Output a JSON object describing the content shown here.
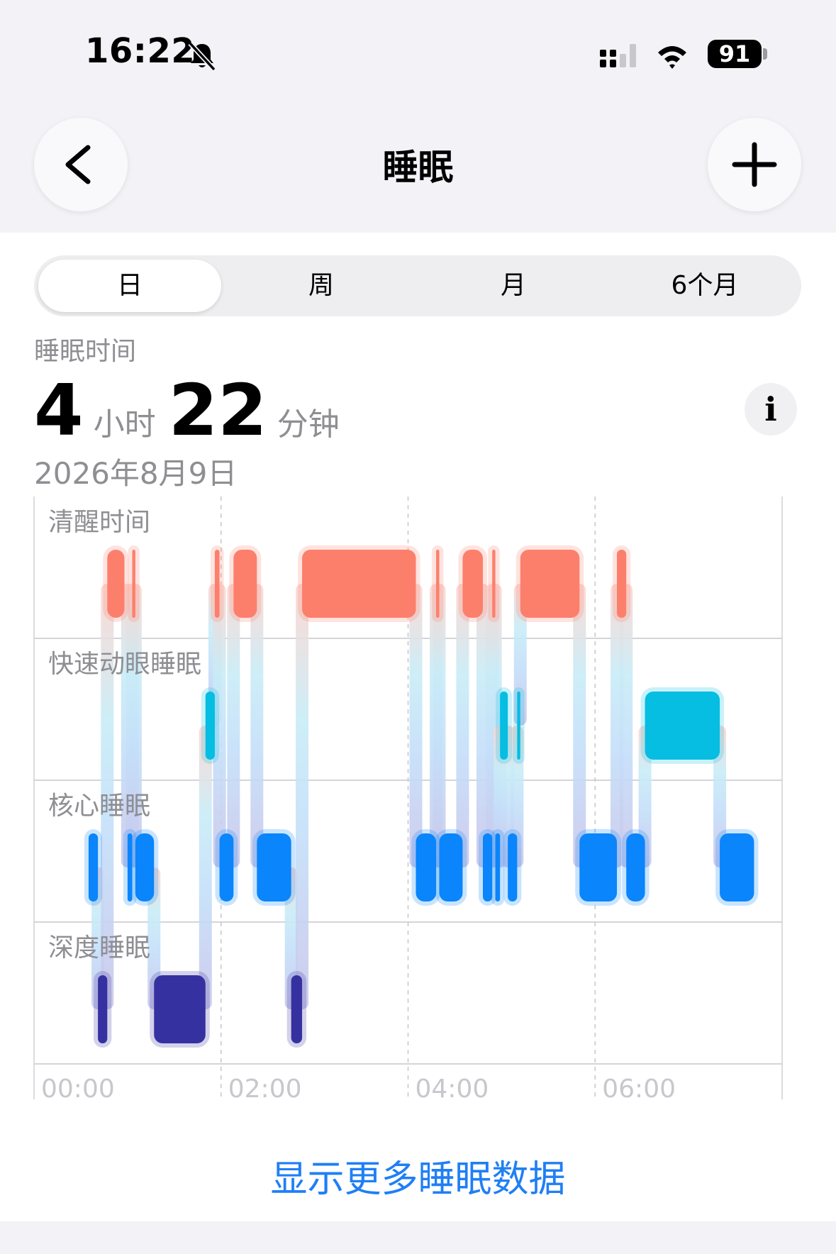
{
  "status_bar": {
    "time": "16:22",
    "battery": "91"
  },
  "nav": {
    "title": "睡眠"
  },
  "segments": [
    "日",
    "周",
    "月",
    "6个月"
  ],
  "summary": {
    "label": "睡眠时间",
    "hours": "4",
    "hours_unit": "小时",
    "minutes": "22",
    "minutes_unit": "分钟",
    "date": "2026年8月9日",
    "info_symbol": "i"
  },
  "chart_data": {
    "type": "sleep-stage-timeline",
    "stages": [
      "清醒时间",
      "快速动眼睡眠",
      "核心睡眠",
      "深度睡眠"
    ],
    "x_tick_labels": [
      "00:00",
      "02:00",
      "04:00",
      "06:00"
    ],
    "x_range_hours": [
      0,
      8
    ],
    "colors": {
      "awake": "#fc7f6c",
      "rem": "#06bde2",
      "core": "#0a85fb",
      "deep": "#3631a0"
    },
    "segments": [
      {
        "stage": "core",
        "start": "00:35",
        "end": "00:41"
      },
      {
        "stage": "deep",
        "start": "00:41",
        "end": "00:47"
      },
      {
        "stage": "awake",
        "start": "00:47",
        "end": "00:58"
      },
      {
        "stage": "core",
        "start": "01:00",
        "end": "01:03"
      },
      {
        "stage": "awake",
        "start": "01:03",
        "end": "01:05"
      },
      {
        "stage": "core",
        "start": "01:05",
        "end": "01:17"
      },
      {
        "stage": "deep",
        "start": "01:17",
        "end": "01:50"
      },
      {
        "stage": "rem",
        "start": "01:50",
        "end": "01:56"
      },
      {
        "stage": "awake",
        "start": "01:56",
        "end": "01:59"
      },
      {
        "stage": "core",
        "start": "01:59",
        "end": "02:08"
      },
      {
        "stage": "awake",
        "start": "02:08",
        "end": "02:23"
      },
      {
        "stage": "core",
        "start": "02:23",
        "end": "02:45"
      },
      {
        "stage": "deep",
        "start": "02:45",
        "end": "02:52"
      },
      {
        "stage": "awake",
        "start": "02:52",
        "end": "04:05"
      },
      {
        "stage": "core",
        "start": "04:05",
        "end": "04:18"
      },
      {
        "stage": "awake",
        "start": "04:18",
        "end": "04:20"
      },
      {
        "stage": "core",
        "start": "04:20",
        "end": "04:35"
      },
      {
        "stage": "awake",
        "start": "04:35",
        "end": "04:48"
      },
      {
        "stage": "core",
        "start": "04:48",
        "end": "04:54"
      },
      {
        "stage": "awake",
        "start": "04:54",
        "end": "04:56"
      },
      {
        "stage": "core",
        "start": "04:56",
        "end": "04:59"
      },
      {
        "stage": "rem",
        "start": "04:59",
        "end": "05:04"
      },
      {
        "stage": "core",
        "start": "05:04",
        "end": "05:10"
      },
      {
        "stage": "rem",
        "start": "05:10",
        "end": "05:12"
      },
      {
        "stage": "awake",
        "start": "05:12",
        "end": "05:50"
      },
      {
        "stage": "core",
        "start": "05:50",
        "end": "06:14"
      },
      {
        "stage": "awake",
        "start": "06:14",
        "end": "06:20"
      },
      {
        "stage": "core",
        "start": "06:20",
        "end": "06:32"
      },
      {
        "stage": "rem",
        "start": "06:32",
        "end": "07:20"
      },
      {
        "stage": "core",
        "start": "07:20",
        "end": "07:42"
      }
    ]
  },
  "footer": {
    "more_link": "显示更多睡眠数据"
  }
}
